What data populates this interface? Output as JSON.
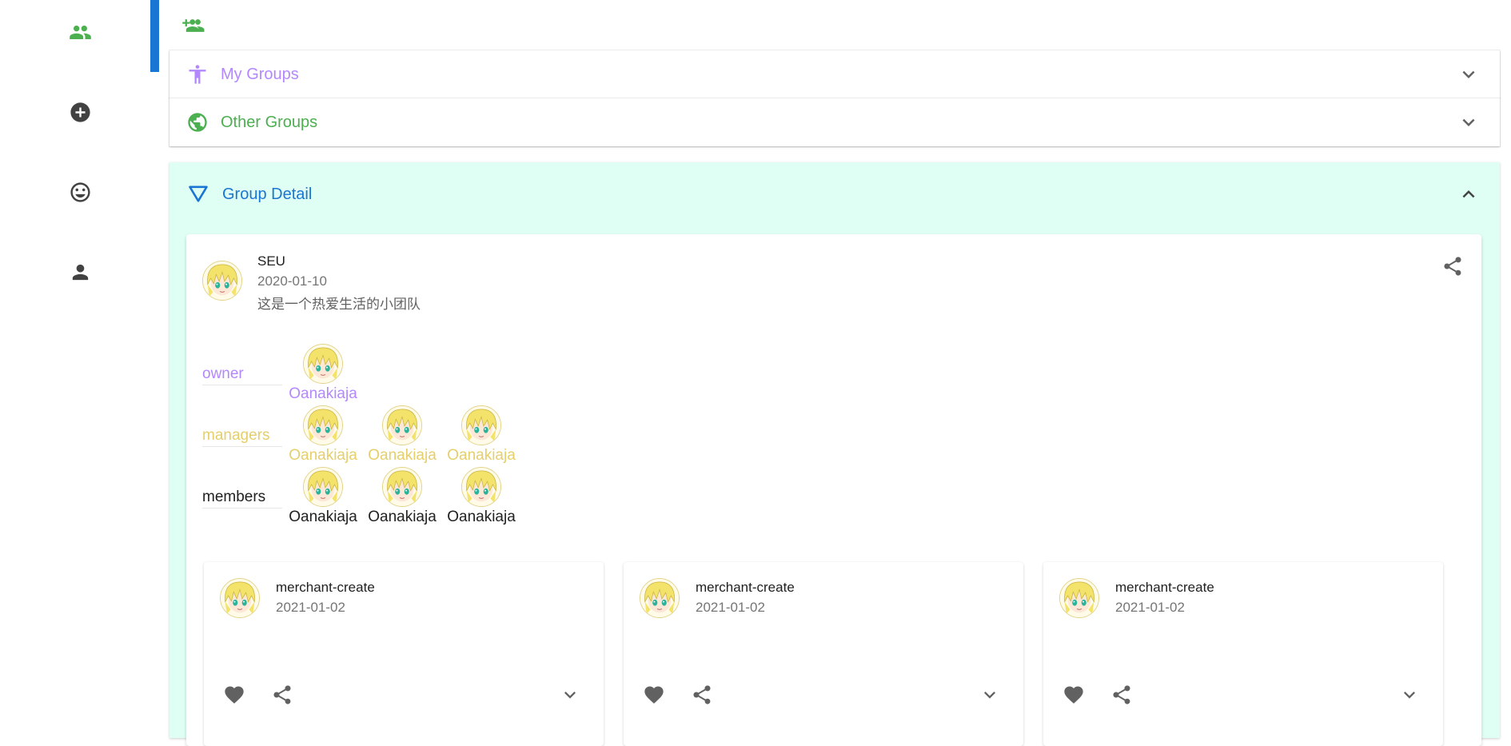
{
  "colors": {
    "nav_active": "#4caf50",
    "nav_icon": "#424242",
    "accent_blue": "#1976d2",
    "owner": "#b388ff",
    "managers": "#e6cf6a",
    "members": "#212121",
    "detail_bg": "#dffff4",
    "other_groups": "#4caf50"
  },
  "rail": {
    "items": [
      {
        "icon": "group-icon",
        "active": true
      },
      {
        "icon": "add-circle-icon",
        "active": false
      },
      {
        "icon": "smiley-icon",
        "active": false
      },
      {
        "icon": "person-icon",
        "active": false
      }
    ]
  },
  "toolbar": {
    "action_icon": "add-group-icon"
  },
  "panels": {
    "my_groups": {
      "title": "My Groups",
      "icon": "accessibility-icon"
    },
    "other_groups": {
      "title": "Other Groups",
      "icon": "globe-icon"
    },
    "group_detail": {
      "title": "Group Detail",
      "icon": "funnel-icon"
    }
  },
  "group": {
    "name": "SEU",
    "date": "2020-01-10",
    "description": "这是一个热爱生活的小团队",
    "roles": {
      "owner": {
        "label": "owner",
        "members": [
          "Oanakiaja"
        ]
      },
      "managers": {
        "label": "managers",
        "members": [
          "Oanakiaja",
          "Oanakiaja",
          "Oanakiaja"
        ]
      },
      "members": {
        "label": "members",
        "members": [
          "Oanakiaja",
          "Oanakiaja",
          "Oanakiaja"
        ]
      }
    }
  },
  "posts": [
    {
      "title": "merchant-create",
      "date": "2021-01-02"
    },
    {
      "title": "merchant-create",
      "date": "2021-01-02"
    },
    {
      "title": "merchant-create",
      "date": "2021-01-02"
    }
  ]
}
